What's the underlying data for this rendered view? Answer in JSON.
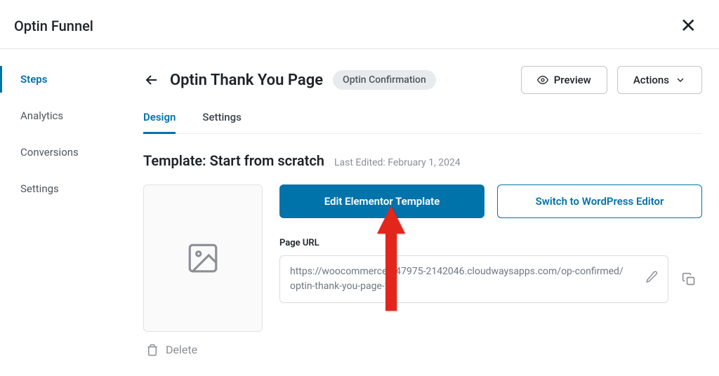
{
  "modal": {
    "title": "Optin Funnel"
  },
  "sidebar": {
    "items": [
      {
        "label": "Steps"
      },
      {
        "label": "Analytics"
      },
      {
        "label": "Conversions"
      },
      {
        "label": "Settings"
      }
    ]
  },
  "header": {
    "title": "Optin Thank You Page",
    "badge": "Optin Confirmation",
    "preview": "Preview",
    "actions": "Actions"
  },
  "tabs": {
    "items": [
      {
        "label": "Design"
      },
      {
        "label": "Settings"
      }
    ]
  },
  "template": {
    "label": "Template: Start from scratch",
    "last_edited": "Last Edited: February 1, 2024",
    "edit_btn": "Edit Elementor Template",
    "switch_btn": "Switch to WordPress Editor",
    "url_label": "Page URL",
    "url_value": "https://woocommerce-547975-2142046.cloudwaysapps.com/op-confirmed/optin-thank-you-page-2",
    "delete": "Delete"
  }
}
